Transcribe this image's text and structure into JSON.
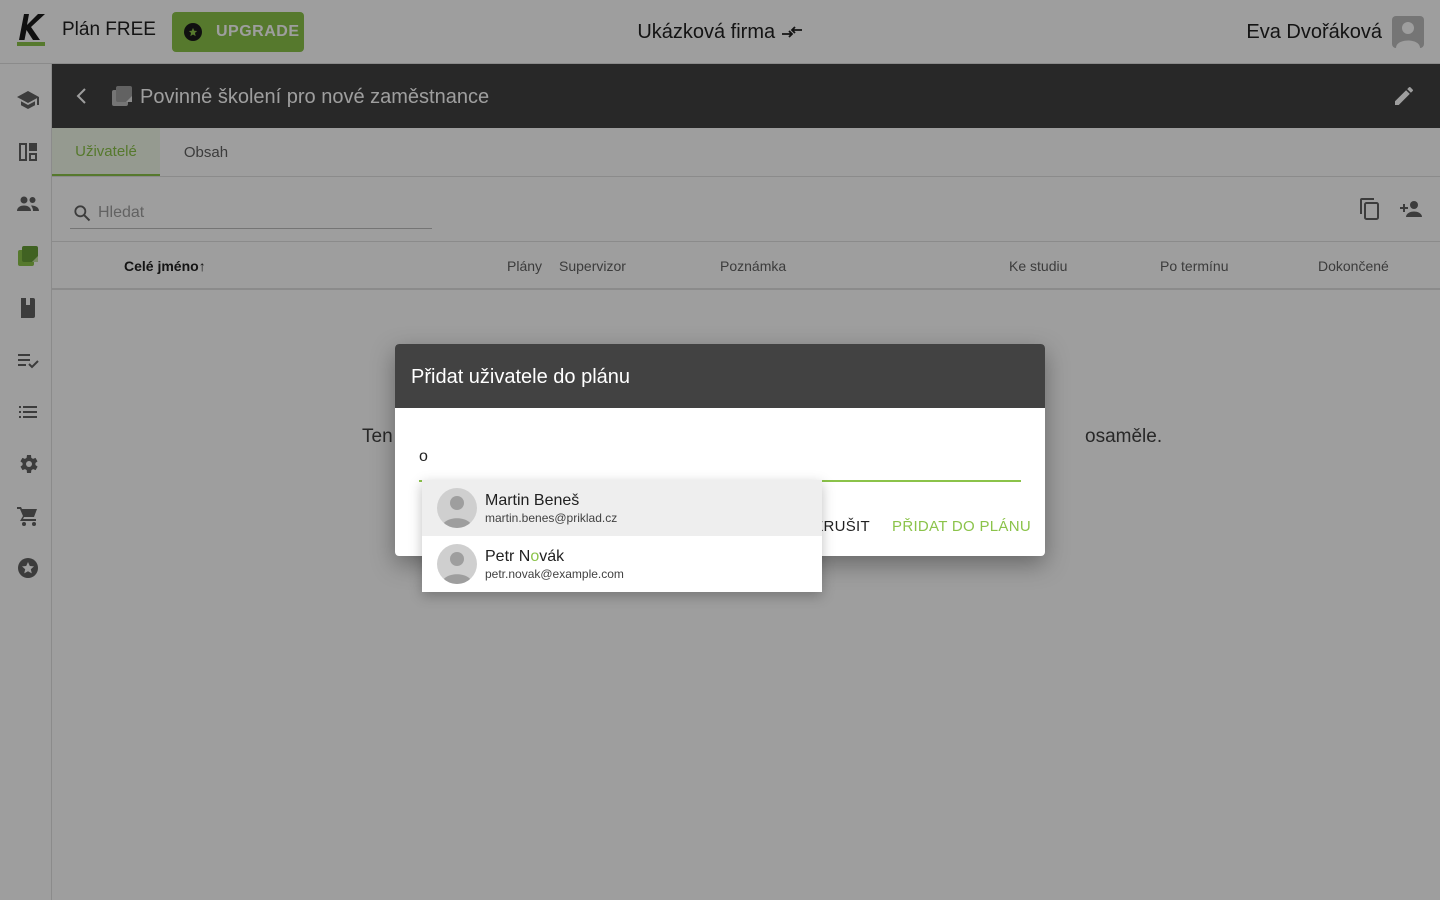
{
  "topbar": {
    "plan_label": "Plán FREE",
    "upgrade_label": "UPGRADE",
    "company_name": "Ukázková firma",
    "user_name": "Eva Dvořáková"
  },
  "sidebar": {
    "items": [
      {
        "icon": "graduation-cap-icon"
      },
      {
        "icon": "dashboard-icon"
      },
      {
        "icon": "people-icon"
      },
      {
        "icon": "plans-icon"
      },
      {
        "icon": "book-icon"
      },
      {
        "icon": "checklist-icon"
      },
      {
        "icon": "list-icon"
      },
      {
        "icon": "gear-icon"
      },
      {
        "icon": "cart-icon"
      },
      {
        "icon": "star-badge-icon"
      }
    ]
  },
  "header": {
    "title": "Povinné školení pro nové zaměstnance"
  },
  "tabs": [
    {
      "label": "Uživatelé",
      "active": true
    },
    {
      "label": "Obsah",
      "active": false
    }
  ],
  "search": {
    "placeholder": "Hledat",
    "value": ""
  },
  "table": {
    "columns": [
      "Celé jméno",
      "Plány",
      "Supervizor",
      "Poznámka",
      "Ke studiu",
      "Po termínu",
      "Dokončené"
    ],
    "sort_indicator": "↑",
    "empty_left": "Ten",
    "empty_right": "osaměle."
  },
  "dialog": {
    "title": "Přidat uživatele do plánu",
    "input_value": "o",
    "cancel_label": "ZRUŠIT",
    "add_label": "PŘIDAT DO PLÁNU"
  },
  "autocomplete": [
    {
      "name": "Martin Beneš",
      "email": "martin.benes@priklad.cz",
      "highlighted": true
    },
    {
      "name_before": "Petr N",
      "name_match": "o",
      "name_after": "vák",
      "email": "petr.novak@example.com",
      "highlighted": false
    }
  ],
  "colors": {
    "accent": "#8bc34a",
    "header_bg": "#424242",
    "overlay": "rgba(0,0,0,0.38)"
  }
}
